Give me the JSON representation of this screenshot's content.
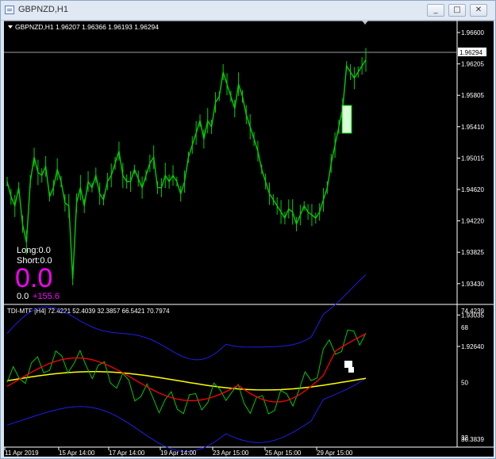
{
  "window": {
    "title": "GBPNZD,H1"
  },
  "window_buttons": [
    "_",
    "□",
    "✕"
  ],
  "main_chart": {
    "header": "GBPNZD,H1  1.96207 1.96366 1.96193 1.96294",
    "price_labels": [
      "1.96600",
      "1.96205",
      "1.95805",
      "1.95410",
      "1.95015",
      "1.94620",
      "1.94220",
      "1.93825",
      "1.93430",
      "1.93035",
      "1.92640"
    ],
    "current_price": "1.96294"
  },
  "stats": {
    "long": "Long:0.0",
    "short": "Short:0.0",
    "big_value": "0.0",
    "pl_left": "0.0",
    "pl_right": "+155.6"
  },
  "indicator": {
    "header": "TDI-MTF [H4] 72.4221 52.4039 32.3857 66.5421 70.7974",
    "labels": [
      "74.4239",
      "68",
      "50",
      "32",
      "30.3839"
    ]
  },
  "time_axis": [
    "11 Apr 2019",
    "15 Apr 14:00",
    "17 Apr 14:00",
    "19 Apr 14:00",
    "23 Apr 15:00",
    "25 Apr 15:00",
    "29 Apr 15:00"
  ],
  "colors": {
    "candle": "#00d000",
    "green_line": "#00c800",
    "red_line": "#ff0000",
    "yellow_line": "#ffff00",
    "blue_line": "#1e1ee6",
    "magenta": "#ff00ff",
    "background": "#000000",
    "grid": "#ffffff"
  },
  "chart_data": {
    "type": "line",
    "title": "GBPNZD,H1",
    "ylim": [
      1.9245,
      1.9675
    ],
    "x": [
      "11 Apr 2019",
      "15 Apr 14:00",
      "17 Apr 14:00",
      "19 Apr 14:00",
      "23 Apr 15:00",
      "25 Apr 15:00",
      "29 Apr 15:00"
    ],
    "series": [
      {
        "name": "GBPNZD,H1",
        "values": [
          1.943,
          1.9405,
          1.939,
          1.942,
          1.936,
          1.933,
          1.943,
          1.947,
          1.9445,
          1.944,
          1.9455,
          1.9405,
          1.942,
          1.945,
          1.943,
          1.9395,
          1.939,
          1.927,
          1.9395,
          1.942,
          1.939,
          1.943,
          1.942,
          1.944,
          1.941,
          1.94,
          1.943,
          1.944,
          1.946,
          1.948,
          1.944,
          1.943,
          1.943,
          1.945,
          1.9435,
          1.942,
          1.944,
          1.946,
          1.947,
          1.942,
          1.942,
          1.944,
          1.943,
          1.944,
          1.943,
          1.941,
          1.943,
          1.947,
          1.949,
          1.951,
          1.953,
          1.95,
          1.953,
          1.952,
          1.956,
          1.957,
          1.961,
          1.959,
          1.957,
          1.955,
          1.959,
          1.957,
          1.954,
          1.952,
          1.95,
          1.948,
          1.945,
          1.943,
          1.941,
          1.94,
          1.939,
          1.938,
          1.937,
          1.9385,
          1.938,
          1.936,
          1.9375,
          1.939,
          1.938,
          1.9375,
          1.937,
          1.938,
          1.94,
          1.942,
          1.946,
          1.949,
          1.952,
          1.955,
          1.962,
          1.961,
          1.96,
          1.961,
          1.962,
          1.963
        ]
      }
    ]
  }
}
